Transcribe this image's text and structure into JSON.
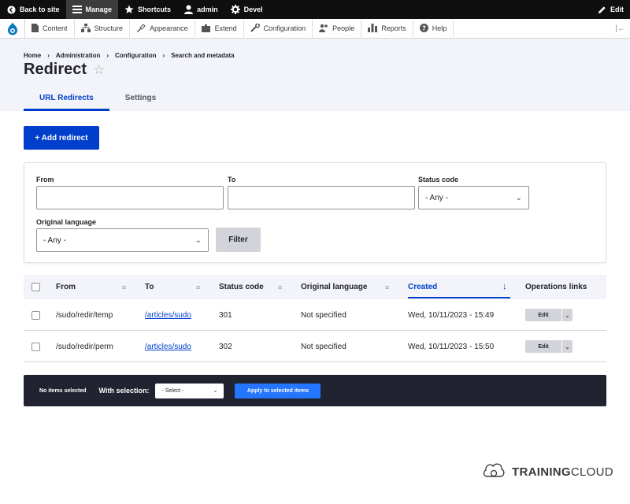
{
  "toolbar": {
    "back": "Back to site",
    "manage": "Manage",
    "shortcuts": "Shortcuts",
    "user": "admin",
    "devel": "Devel",
    "edit": "Edit"
  },
  "tray": {
    "items": [
      "Content",
      "Structure",
      "Appearance",
      "Extend",
      "Configuration",
      "People",
      "Reports",
      "Help"
    ]
  },
  "breadcrumb": [
    "Home",
    "Administration",
    "Configuration",
    "Search and metadata"
  ],
  "page_title": "Redirect",
  "tabs": [
    "URL Redirects",
    "Settings"
  ],
  "add_button": "+ Add redirect",
  "filter": {
    "from_label": "From",
    "to_label": "To",
    "status_label": "Status code",
    "status_value": "- Any -",
    "language_label": "Original language",
    "language_value": "- Any -",
    "filter_button": "Filter"
  },
  "table": {
    "headers": {
      "from": "From",
      "to": "To",
      "status": "Status code",
      "language": "Original language",
      "created": "Created",
      "operations": "Operations links"
    },
    "rows": [
      {
        "from": "/sudo/redir/temp",
        "to": "/articles/sudo",
        "status": "301",
        "language": "Not specified",
        "created": "Wed, 10/11/2023 - 15:49",
        "op": "Edit"
      },
      {
        "from": "/sudo/redir/perm",
        "to": "/articles/sudo",
        "status": "302",
        "language": "Not specified",
        "created": "Wed, 10/11/2023 - 15:50",
        "op": "Edit"
      }
    ]
  },
  "bulk": {
    "count": "No items selected",
    "with_selection": "With selection:",
    "select_value": "- Select -",
    "apply": "Apply to selected items"
  },
  "brand": {
    "bold": "TRAINING",
    "normal": "CLOUD"
  },
  "colors": {
    "accent": "#003ecc",
    "toolbar": "#0f0f0f",
    "bulk_bar": "#222330"
  }
}
